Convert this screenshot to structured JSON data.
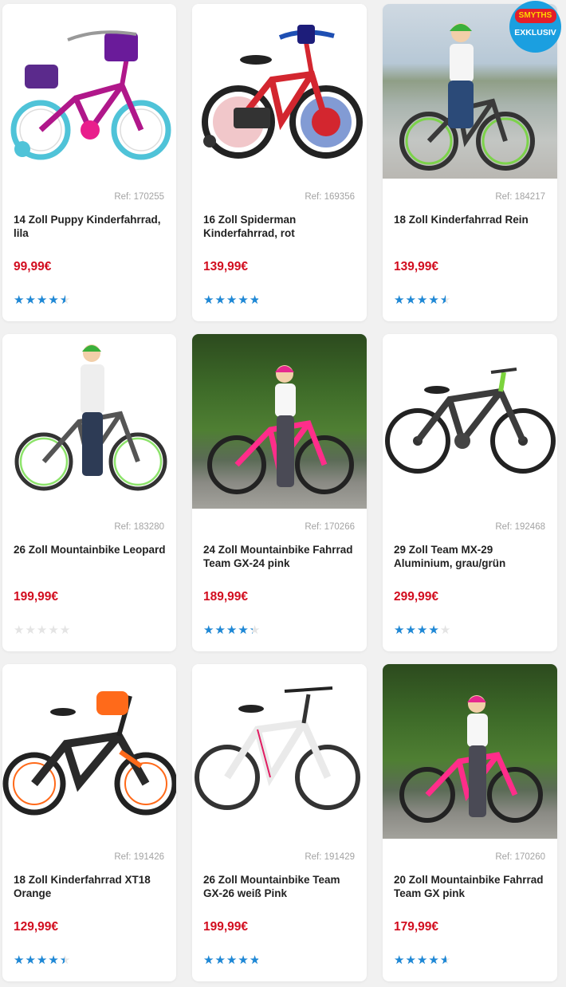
{
  "products": [
    {
      "ref": "Ref: 170255",
      "title": "14 Zoll Puppy Kinderfahrrad, lila",
      "price": "99,99€",
      "rating": 4.5,
      "image": "purple-kids-bike-image"
    },
    {
      "ref": "Ref: 169356",
      "title": "16 Zoll Spiderman Kinderfahrrad, rot",
      "price": "139,99€",
      "rating": 4.8,
      "image": "red-spiderman-bike-image"
    },
    {
      "ref": "Ref: 184217",
      "title": "18 Zoll Kinderfahrrad Rein",
      "price": "139,99€",
      "rating": 4.5,
      "image": "boy-green-bike-photo"
    },
    {
      "ref": "Ref: 183280",
      "title": "26 Zoll Mountainbike Leopard",
      "price": "199,99€",
      "rating": 0,
      "image": "boy-grey-mountainbike-photo"
    },
    {
      "ref": "Ref: 170266",
      "title": "24 Zoll Mountainbike Fahrrad Team GX-24 pink",
      "price": "189,99€",
      "rating": 4.3,
      "image": "girl-pink-mountainbike-photo"
    },
    {
      "ref": "Ref: 192468",
      "title": "29 Zoll Team MX-29 Aluminium, grau/grün",
      "price": "299,99€",
      "rating": 4.0,
      "image": "grey-green-mountainbike-image"
    },
    {
      "ref": "Ref: 191426",
      "title": "18 Zoll Kinderfahrrad XT18 Orange",
      "price": "129,99€",
      "rating": 4.4,
      "image": "black-orange-bmx-image"
    },
    {
      "ref": "Ref: 191429",
      "title": "26 Zoll Mountainbike Team GX-26 weiß Pink",
      "price": "199,99€",
      "rating": 4.8,
      "image": "white-pink-mountainbike-image"
    },
    {
      "ref": "Ref: 170260",
      "title": "20 Zoll Mountainbike Fahrrad Team GX pink",
      "price": "179,99€",
      "rating": 4.6,
      "image": "girl-pink-bike-photo"
    }
  ],
  "badge": {
    "brand": "SMYTHS",
    "text": "EXKLUSIV"
  },
  "colors": {
    "price": "#d20d1f",
    "star": "#1e88d6",
    "badge": "#1b9fe0"
  }
}
